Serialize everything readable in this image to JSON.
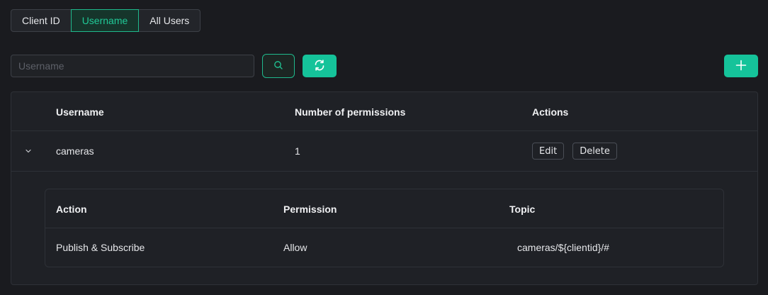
{
  "tabs": [
    {
      "label": "Client ID"
    },
    {
      "label": "Username"
    },
    {
      "label": "All Users"
    }
  ],
  "active_tab": "Username",
  "search": {
    "placeholder": "Username",
    "value": ""
  },
  "colors": {
    "accent": "#15c39a",
    "active_tab_text": "#20c997"
  },
  "icons": {
    "search": "search-icon",
    "refresh": "refresh-icon",
    "add": "plus-icon",
    "expand": "chevron-down-icon"
  },
  "table": {
    "headers": {
      "username": "Username",
      "permissions": "Number of permissions",
      "actions": "Actions"
    },
    "rows": [
      {
        "username": "cameras",
        "permissions": "1",
        "edit_label": "Edit",
        "delete_label": "Delete",
        "expanded": true
      }
    ]
  },
  "permissions_table": {
    "headers": {
      "action": "Action",
      "permission": "Permission",
      "topic": "Topic"
    },
    "rows": [
      {
        "action": "Publish & Subscribe",
        "permission": "Allow",
        "topic": "cameras/${clientid}/#"
      }
    ]
  }
}
